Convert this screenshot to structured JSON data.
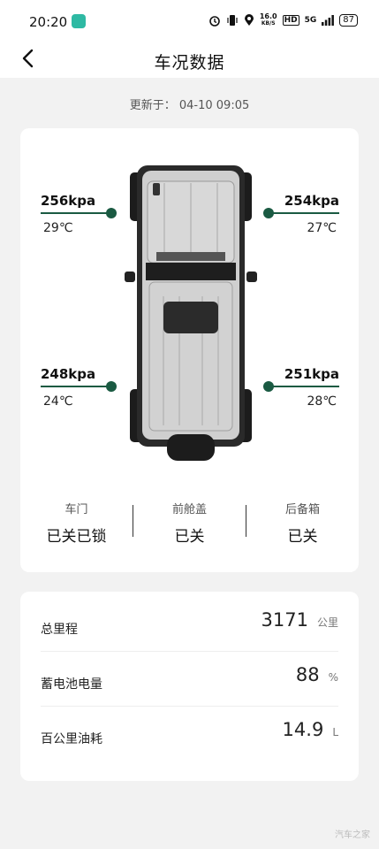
{
  "status_bar": {
    "time": "20:20",
    "net_speed_value": "16.0",
    "net_speed_unit": "KB/S",
    "hd": "HD",
    "signal": "5G",
    "battery": "87"
  },
  "header": {
    "title": "车况数据"
  },
  "updated_text": "更新于： 04-10  09:05",
  "tires": {
    "front_left": {
      "pressure": "256kpa",
      "temp": "29℃"
    },
    "front_right": {
      "pressure": "254kpa",
      "temp": "27℃"
    },
    "rear_left": {
      "pressure": "248kpa",
      "temp": "24℃"
    },
    "rear_right": {
      "pressure": "251kpa",
      "temp": "28℃"
    }
  },
  "status_items": [
    {
      "label": "车门",
      "value": "已关已锁"
    },
    {
      "label": "前舱盖",
      "value": "已关"
    },
    {
      "label": "后备箱",
      "value": "已关"
    }
  ],
  "stats": [
    {
      "label": "总里程",
      "value": "3171",
      "unit": "公里"
    },
    {
      "label": "蓄电池电量",
      "value": "88",
      "unit": "%"
    },
    {
      "label": "百公里油耗",
      "value": "14.9",
      "unit": "L"
    }
  ],
  "watermark": "汽车之家",
  "colors": {
    "accent": "#1a5a42",
    "background": "#f2f2f2",
    "card": "#ffffff"
  }
}
